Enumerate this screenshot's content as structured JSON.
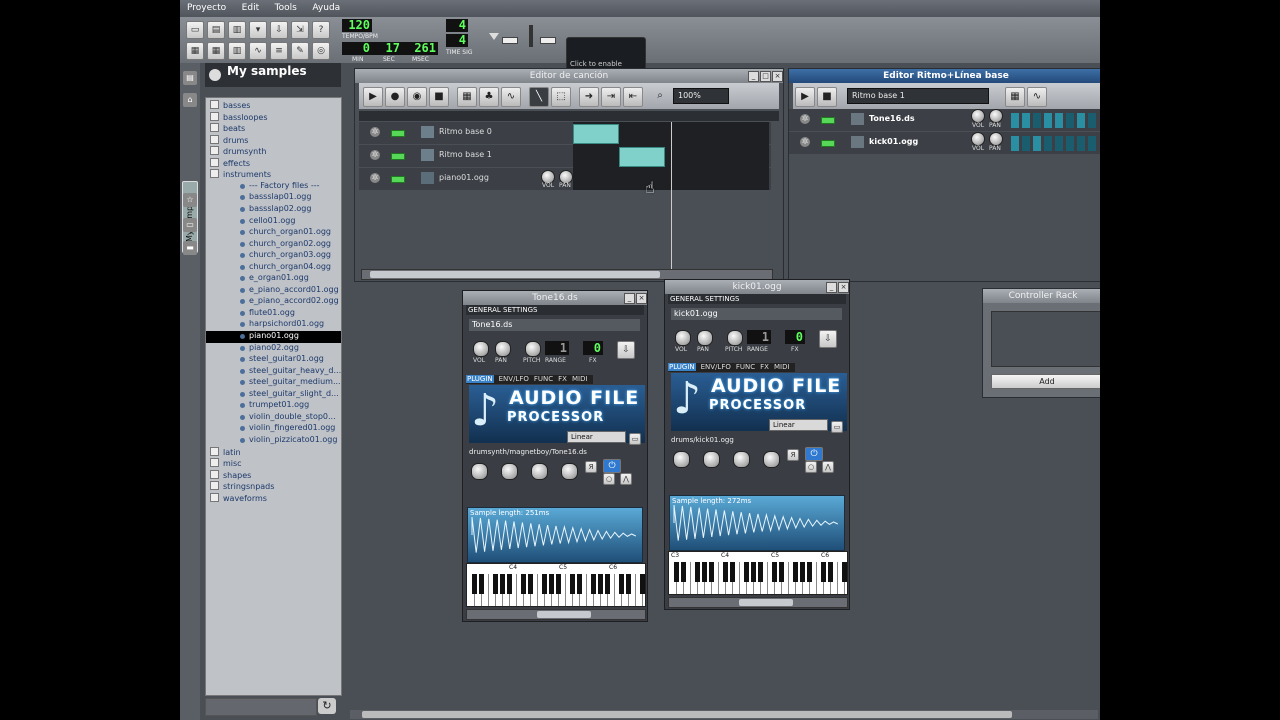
{
  "menu": [
    "Proyecto",
    "Edit",
    "Tools",
    "Ayuda"
  ],
  "transport": {
    "tempo": "120",
    "tempo_label": "TEMPO/BPM",
    "min": "0",
    "sec": "17",
    "msec": "261",
    "min_label": "MIN",
    "sec_label": "SEC",
    "msec_label": "MSEC",
    "timesig_num": "4",
    "timesig_den": "4",
    "timesig_label": "TIME SIG",
    "cpu_text": "Click to enable",
    "cpu_label": "CPU"
  },
  "browser": {
    "title": "My samples",
    "side_tab": "My samples",
    "items": [
      {
        "label": "basses",
        "level": 0
      },
      {
        "label": "bassloopes",
        "level": 0
      },
      {
        "label": "beats",
        "level": 0
      },
      {
        "label": "drums",
        "level": 0
      },
      {
        "label": "drumsynth",
        "level": 0
      },
      {
        "label": "effects",
        "level": 0
      },
      {
        "label": "instruments",
        "level": 0
      },
      {
        "label": "--- Factory files ---",
        "level": 1
      },
      {
        "label": "bassslap01.ogg",
        "level": 1
      },
      {
        "label": "bassslap02.ogg",
        "level": 1
      },
      {
        "label": "cello01.ogg",
        "level": 1
      },
      {
        "label": "church_organ01.ogg",
        "level": 1
      },
      {
        "label": "church_organ02.ogg",
        "level": 1
      },
      {
        "label": "church_organ03.ogg",
        "level": 1
      },
      {
        "label": "church_organ04.ogg",
        "level": 1
      },
      {
        "label": "e_organ01.ogg",
        "level": 1
      },
      {
        "label": "e_piano_accord01.ogg",
        "level": 1
      },
      {
        "label": "e_piano_accord02.ogg",
        "level": 1
      },
      {
        "label": "flute01.ogg",
        "level": 1
      },
      {
        "label": "harpsichord01.ogg",
        "level": 1
      },
      {
        "label": "piano01.ogg",
        "level": 1,
        "selected": true
      },
      {
        "label": "piano02.ogg",
        "level": 1
      },
      {
        "label": "steel_guitar01.ogg",
        "level": 1
      },
      {
        "label": "steel_guitar_heavy_d...",
        "level": 1
      },
      {
        "label": "steel_guitar_medium...",
        "level": 1
      },
      {
        "label": "steel_guitar_slight_d...",
        "level": 1
      },
      {
        "label": "trumpet01.ogg",
        "level": 1
      },
      {
        "label": "violin_double_stop0...",
        "level": 1
      },
      {
        "label": "violin_fingered01.ogg",
        "level": 1
      },
      {
        "label": "violin_pizzicato01.ogg",
        "level": 1
      },
      {
        "label": "latin",
        "level": 0
      },
      {
        "label": "misc",
        "level": 0
      },
      {
        "label": "shapes",
        "level": 0
      },
      {
        "label": "stringsnpads",
        "level": 0
      },
      {
        "label": "waveforms",
        "level": 0
      }
    ]
  },
  "song_editor": {
    "title": "Editor de canción",
    "zoom": "100%",
    "tracks": [
      {
        "name": "Ritmo base 0"
      },
      {
        "name": "Ritmo base 1"
      },
      {
        "name": "piano01.ogg"
      }
    ],
    "vol_label": "VOL",
    "pan_label": "PAN"
  },
  "bb_editor": {
    "title": "Editor Ritmo+Línea base",
    "selected_beat": "Ritmo base 1",
    "tracks": [
      {
        "name": "Tone16.ds",
        "steps": [
          1,
          1,
          0,
          1,
          1,
          0,
          1,
          0
        ]
      },
      {
        "name": "kick01.ogg",
        "steps": [
          1,
          0,
          1,
          0,
          0,
          0,
          0,
          0
        ]
      }
    ],
    "vol_label": "VOL",
    "pan_label": "PAN"
  },
  "plugins": [
    {
      "title": "Tone16.ds",
      "general": "GENERAL SETTINGS",
      "name": "Tone16.ds",
      "range_lcd": "1",
      "fx_lcd": "0",
      "tabs": [
        "PLUGIN",
        "ENV/LFO",
        "FUNC",
        "FX",
        "MIDI"
      ],
      "logo1": "AUDIO FILE",
      "logo2": "PROCESSOR",
      "interp": "Linear",
      "path": "drumsynth/magnetboy/Tone16.ds",
      "sample_length": "Sample length: 251ms",
      "octaves": [
        "C4",
        "C5",
        "C6"
      ]
    },
    {
      "title": "kick01.ogg",
      "general": "GENERAL SETTINGS",
      "name": "kick01.ogg",
      "range_lcd": "1",
      "fx_lcd": "0",
      "tabs": [
        "PLUGIN",
        "ENV/LFO",
        "FUNC",
        "FX",
        "MIDI"
      ],
      "logo1": "AUDIO FILE",
      "logo2": "PROCESSOR",
      "interp": "Linear",
      "path": "drums/kick01.ogg",
      "sample_length": "Sample length: 272ms",
      "octaves": [
        "C3",
        "C4",
        "C5",
        "C6"
      ]
    }
  ],
  "knob_labels": {
    "vol": "VOL",
    "pan": "PAN",
    "pitch": "PITCH",
    "range": "RANGE",
    "fx": "FX"
  },
  "controller_rack": {
    "title": "Controller Rack",
    "add": "Add"
  }
}
